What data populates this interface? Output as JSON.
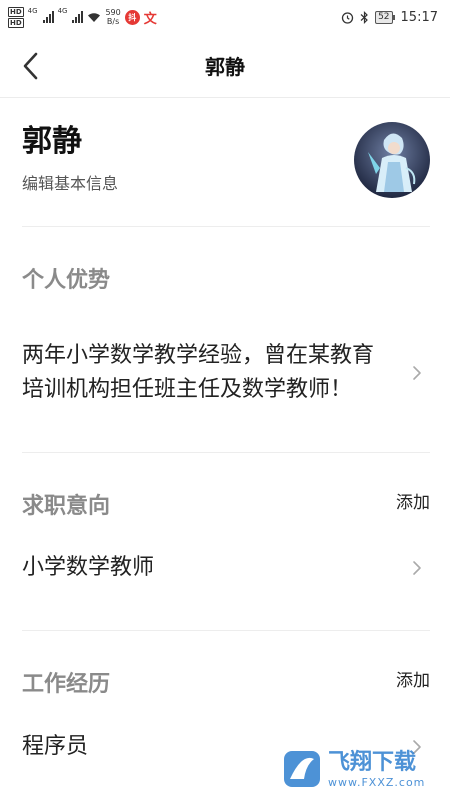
{
  "status_bar": {
    "hd1": "HD",
    "hd2": "HD",
    "net1": "4G",
    "net2": "4G",
    "speed_value": "590",
    "speed_unit": "B/s",
    "app_badge": "抖",
    "app_text": "文",
    "battery": "52",
    "time": "15:17"
  },
  "nav": {
    "title": "郭静"
  },
  "profile": {
    "name": "郭静",
    "edit_label": "编辑基本信息"
  },
  "sections": {
    "advantage": {
      "title": "个人优势",
      "content": "两年小学数学教学经验，曾在某教育培训机构担任班主任及数学教师！"
    },
    "intention": {
      "title": "求职意向",
      "add_label": "添加",
      "content": "小学数学教师"
    },
    "experience": {
      "title": "工作经历",
      "add_label": "添加",
      "content": "程序员"
    }
  },
  "watermark": {
    "text": "飞翔下载",
    "url": "www.FXXZ.com"
  },
  "colors": {
    "section_title": "#8a8a8a",
    "divider": "#ededed",
    "badge_red": "#e53935"
  }
}
